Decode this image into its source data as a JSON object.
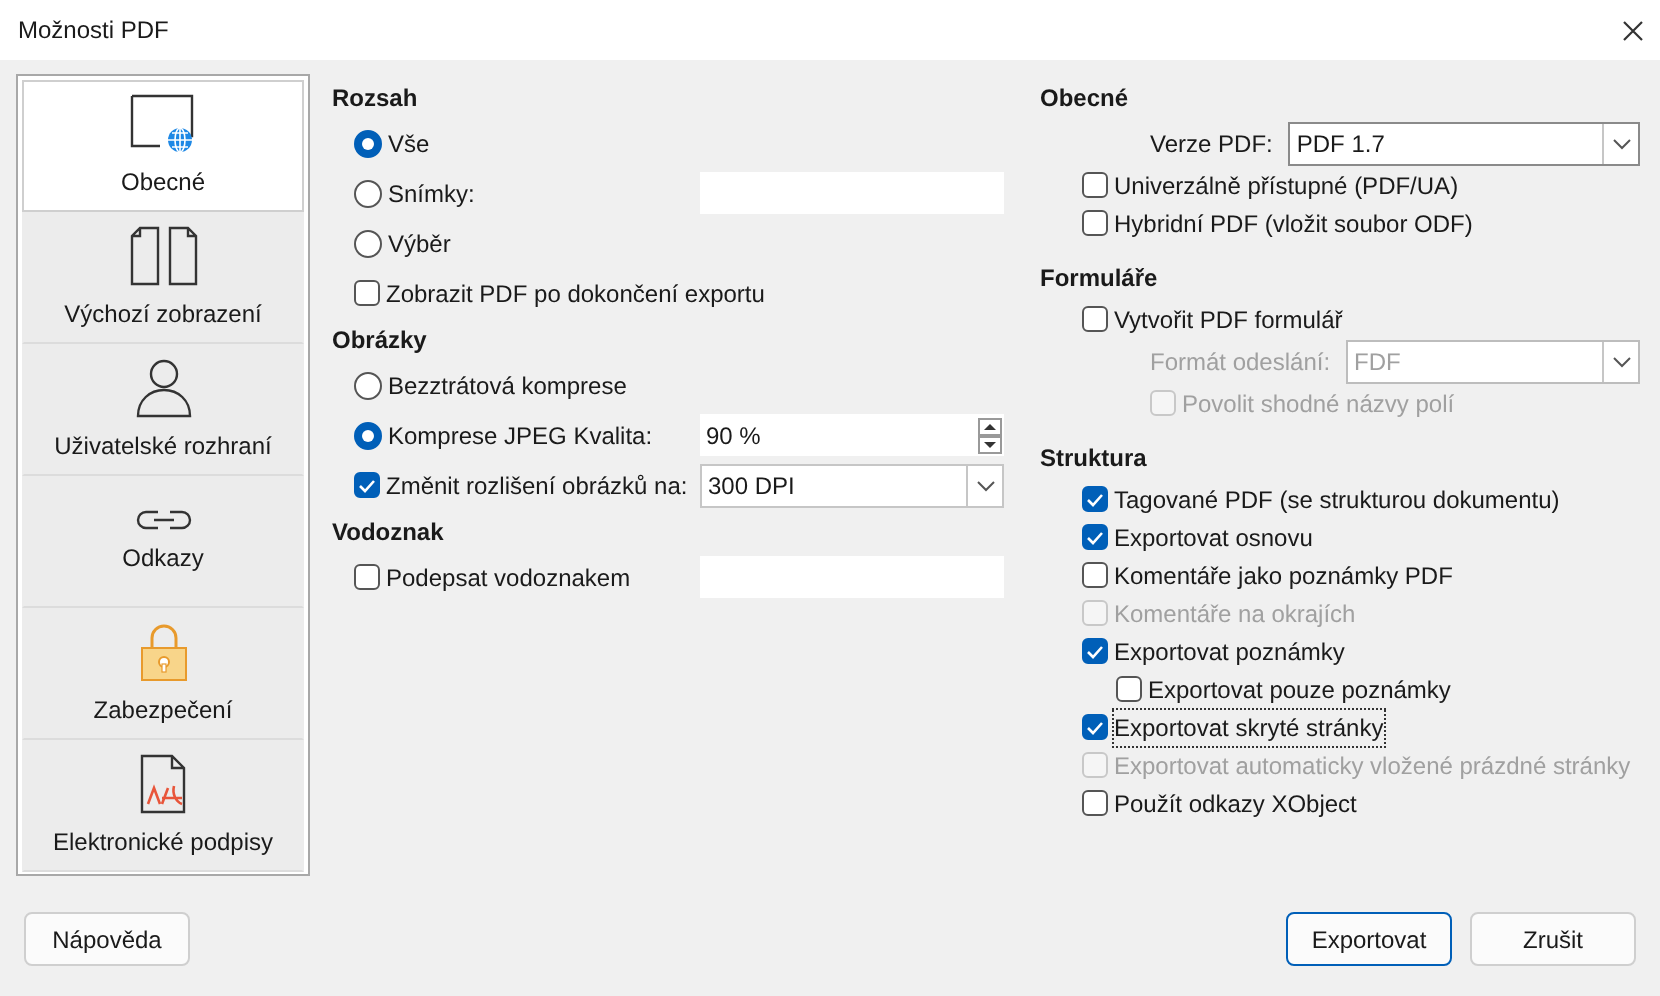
{
  "window": {
    "title": "Možnosti PDF"
  },
  "sidebar": {
    "items": [
      {
        "kind": "page-globe",
        "label": "Obecné",
        "selected": true
      },
      {
        "kind": "two-pages",
        "label": "Výchozí zobrazení",
        "selected": false
      },
      {
        "kind": "person",
        "label": "Uživatelské rozhraní",
        "selected": false
      },
      {
        "kind": "link",
        "label": "Odkazy",
        "selected": false
      },
      {
        "kind": "lock",
        "label": "Zabezpečení",
        "selected": false
      },
      {
        "kind": "signature",
        "label": "Elektronické podpisy",
        "selected": false
      }
    ]
  },
  "columns": [
    [
      {
        "title": "Rozsah",
        "rows": [
          {
            "kind": "radio",
            "label": "Vše",
            "selected": true
          },
          {
            "kind": "radio",
            "label": "Snímky:",
            "selected": false,
            "input": {
              "kind": "text"
            }
          },
          {
            "kind": "radio",
            "label": "Výběr",
            "selected": false
          },
          {
            "kind": "checkbox",
            "label": "Zobrazit PDF po dokončení exportu",
            "checked": false
          }
        ]
      },
      {
        "title": "Obrázky",
        "rows": [
          {
            "kind": "radio",
            "label": "Bezztrátová komprese",
            "selected": false
          },
          {
            "kind": "radio",
            "label": "Komprese JPEG  Kvalita:",
            "selected": true,
            "input": {
              "kind": "spin",
              "value": "90 %"
            }
          },
          {
            "kind": "checkbox",
            "label": "Změnit rozlišení obrázků na:",
            "checked": true,
            "input": {
              "kind": "combo",
              "value": "300 DPI"
            }
          }
        ]
      },
      {
        "title": "Vodoznak",
        "rows": [
          {
            "kind": "checkbox",
            "label": "Podepsat vodoznakem",
            "checked": false,
            "input": {
              "kind": "text"
            }
          }
        ]
      }
    ],
    [
      {
        "title": "Obecné",
        "rows": [
          {
            "kind": "select",
            "label": "Verze PDF:",
            "value": "PDF 1.7",
            "disabled": false
          },
          {
            "kind": "checkbox",
            "label": "Univerzálně přístupné (PDF/UA)",
            "checked": false,
            "disabled": false
          },
          {
            "kind": "checkbox",
            "label": "Hybridní PDF (vložit soubor ODF)",
            "checked": false,
            "disabled": false
          }
        ]
      },
      {
        "title": "Formuláře",
        "rows": [
          {
            "kind": "checkbox",
            "label": "Vytvořit PDF formulář",
            "checked": false,
            "disabled": false
          },
          {
            "kind": "select",
            "label": "Formát odeslání:",
            "value": "FDF",
            "disabled": true
          },
          {
            "kind": "checkbox",
            "label": "Povolit shodné názvy polí",
            "checked": false,
            "disabled": true,
            "indent": true
          }
        ]
      },
      {
        "title": "Struktura",
        "rows": [
          {
            "kind": "checkbox",
            "label": "Tagované PDF (se strukturou dokumentu)",
            "checked": true,
            "disabled": false
          },
          {
            "kind": "checkbox",
            "label": "Exportovat osnovu",
            "checked": true,
            "disabled": false
          },
          {
            "kind": "checkbox",
            "label": "Komentáře jako poznámky PDF",
            "checked": false,
            "disabled": false
          },
          {
            "kind": "checkbox",
            "label": "Komentáře na okrajích",
            "checked": false,
            "disabled": true
          },
          {
            "kind": "checkbox",
            "label": "Exportovat poznámky",
            "checked": true,
            "disabled": false,
            "children": [
              {
                "kind": "checkbox",
                "label": "Exportovat pouze poznámky",
                "checked": false,
                "disabled": false
              }
            ]
          },
          {
            "kind": "checkbox",
            "label": "Exportovat skryté stránky",
            "checked": true,
            "disabled": false,
            "focused": true
          },
          {
            "kind": "checkbox",
            "label": "Exportovat automaticky vložené prázdné stránky",
            "checked": false,
            "disabled": true
          },
          {
            "kind": "checkbox",
            "label": "Použít odkazy XObject",
            "checked": false,
            "disabled": false
          }
        ]
      }
    ]
  ],
  "buttons": [
    {
      "label": "Nápověda",
      "primary": false
    },
    {
      "label": "Exportovat",
      "primary": true
    },
    {
      "label": "Zrušit",
      "primary": false
    }
  ]
}
